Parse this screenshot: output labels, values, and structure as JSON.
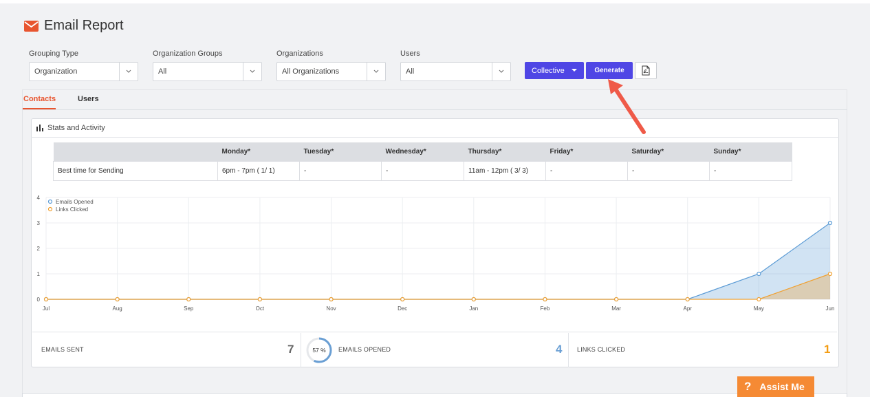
{
  "page": {
    "title": "Email Report",
    "title_icon": "envelope-icon"
  },
  "filters": {
    "grouping_type": {
      "label": "Grouping Type",
      "value": "Organization"
    },
    "organization_groups": {
      "label": "Organization Groups",
      "value": "All"
    },
    "organizations": {
      "label": "Organizations",
      "value": "All Organizations"
    },
    "users": {
      "label": "Users",
      "value": "All"
    }
  },
  "actions": {
    "collective": "Collective",
    "generate": "Generate",
    "pdf_icon": "pdf-file-icon"
  },
  "tabs": [
    {
      "label": "Contacts",
      "active": true
    },
    {
      "label": "Users",
      "active": false
    }
  ],
  "panel": {
    "title": "Stats and Activity",
    "icon": "bar-chart-icon"
  },
  "best_time": {
    "headers": [
      "",
      "Monday*",
      "Tuesday*",
      "Wednesday*",
      "Thursday*",
      "Friday*",
      "Saturday*",
      "Sunday*"
    ],
    "row": [
      "Best time for Sending",
      "6pm - 7pm ( 1/ 1)",
      "-",
      "-",
      "11am - 12pm ( 3/ 3)",
      "-",
      "-",
      "-"
    ]
  },
  "chart_data": {
    "type": "area",
    "categories": [
      "Jul",
      "Aug",
      "Sep",
      "Oct",
      "Nov",
      "Dec",
      "Jan",
      "Feb",
      "Mar",
      "Apr",
      "May",
      "Jun"
    ],
    "series": [
      {
        "name": "Emails Opened",
        "values": [
          0,
          0,
          0,
          0,
          0,
          0,
          0,
          0,
          0,
          0,
          1,
          3
        ],
        "color": "#5b9bd5"
      },
      {
        "name": "Links Clicked",
        "values": [
          0,
          0,
          0,
          0,
          0,
          0,
          0,
          0,
          0,
          0,
          0,
          1
        ],
        "color": "#f0a030"
      }
    ],
    "ylim": [
      0,
      4
    ],
    "yticks": [
      "0",
      "1",
      "2",
      "3",
      "4"
    ],
    "grid": true,
    "legend": "top-left"
  },
  "stats": {
    "emails_sent": {
      "label": "EMAILS SENT",
      "value": "7",
      "color": "#666666"
    },
    "emails_opened": {
      "label": "EMAILS OPENED",
      "value": "4",
      "percent": "57 %",
      "fraction": 0.57,
      "color": "#6a9fd4"
    },
    "links_clicked": {
      "label": "LINKS CLICKED",
      "value": "1",
      "color": "#f39c12"
    }
  },
  "assist": {
    "label": "Assist Me",
    "icon": "question-icon"
  },
  "colors": {
    "accent": "#4f46e5",
    "brand": "#e8552f",
    "assist": "#f58a34"
  }
}
